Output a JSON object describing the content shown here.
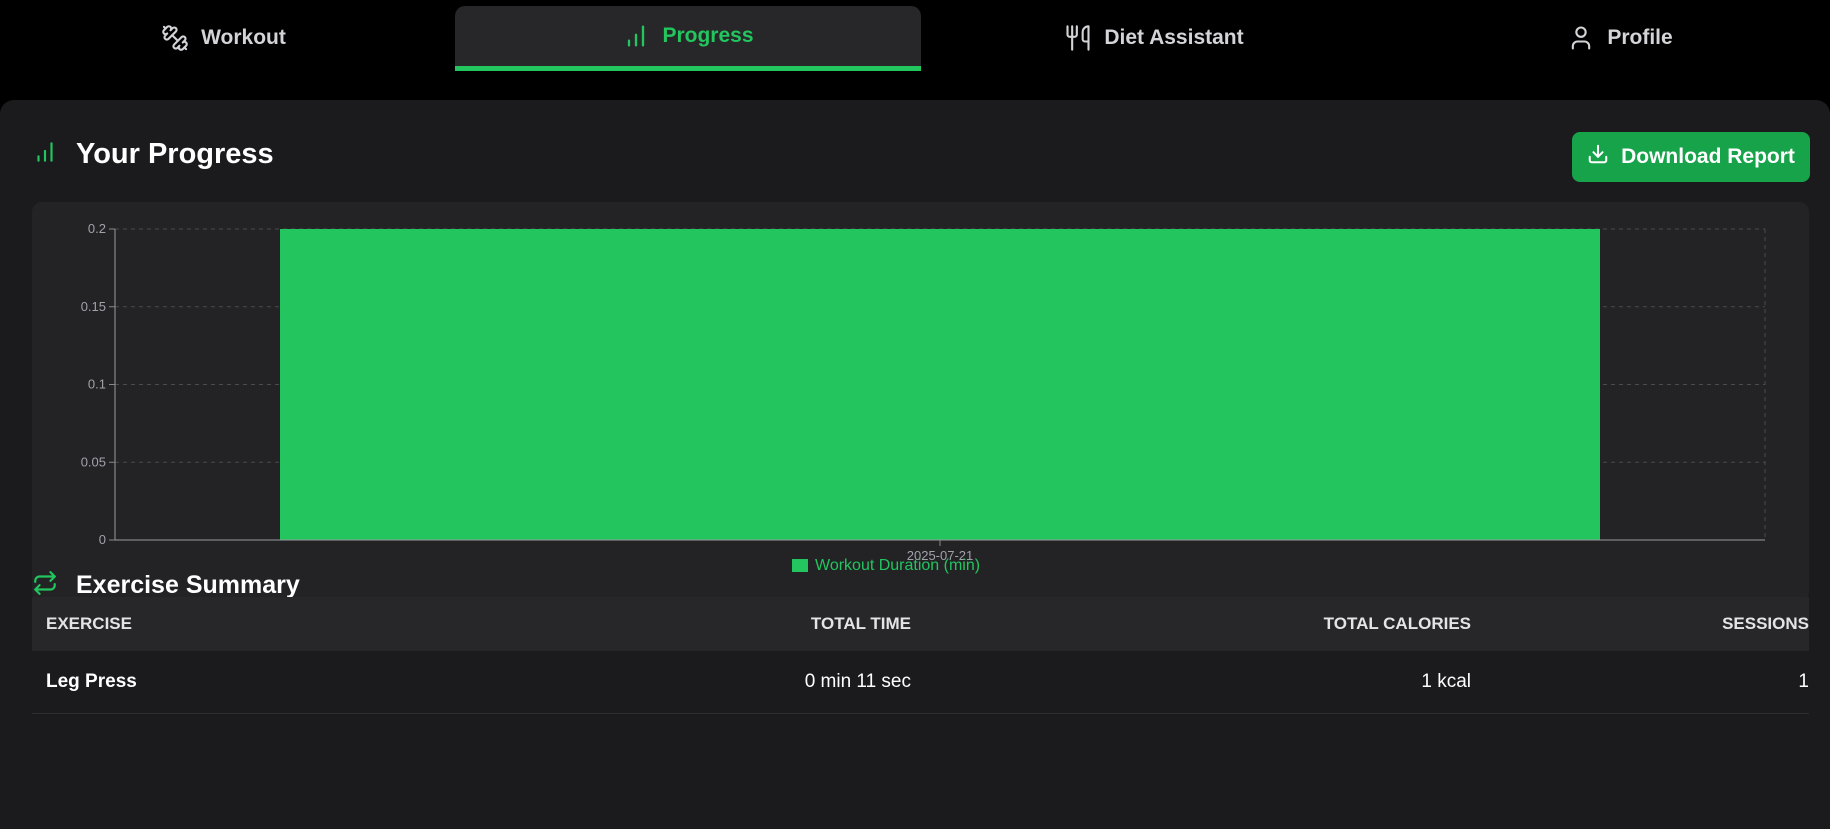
{
  "colors": {
    "accent": "#22c55e",
    "button": "#16a34a",
    "panel": "#1b1b1e"
  },
  "nav": {
    "tabs": [
      {
        "label": "Workout",
        "icon": "dumbbell-icon",
        "active": false
      },
      {
        "label": "Progress",
        "icon": "bar-chart-icon",
        "active": true
      },
      {
        "label": "Diet Assistant",
        "icon": "utensils-icon",
        "active": false
      },
      {
        "label": "Profile",
        "icon": "user-icon",
        "active": false
      }
    ]
  },
  "progress": {
    "title": "Your Progress",
    "icon": "bar-chart-icon",
    "download_label": "Download Report",
    "download_icon": "download-icon"
  },
  "chart_data": {
    "type": "bar",
    "categories": [
      "2025-07-21"
    ],
    "series": [
      {
        "name": "Workout Duration (min)",
        "values": [
          0.2
        ],
        "color": "#22c55e"
      }
    ],
    "yticks": [
      "0",
      "0.05",
      "0.1",
      "0.15",
      "0.2"
    ],
    "ylim": [
      0,
      0.2
    ],
    "grid": true,
    "legend": "bottom"
  },
  "summary": {
    "title": "Exercise Summary",
    "icon": "repeat-icon",
    "columns": [
      "Exercise",
      "Total Time",
      "Total Calories",
      "Sessions"
    ],
    "rows": [
      {
        "exercise": "Leg Press",
        "time": "0 min 11 sec",
        "calories": "1 kcal",
        "sessions": "1"
      }
    ]
  }
}
